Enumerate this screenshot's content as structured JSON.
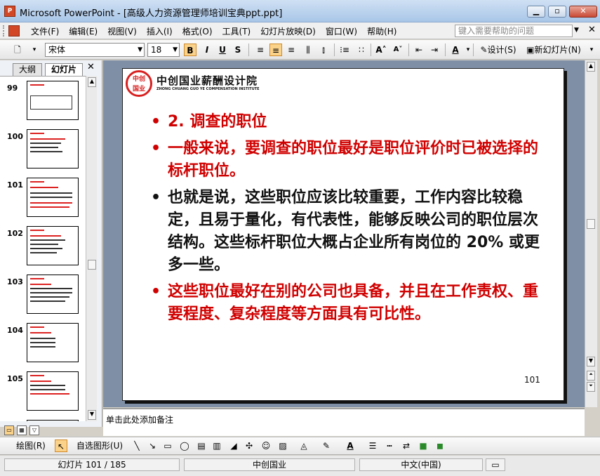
{
  "window": {
    "title": "Microsoft PowerPoint - [高级人力资源管理师培训宝典ppt.ppt]",
    "app_icon": "P"
  },
  "menu": {
    "items": [
      "文件(F)",
      "编辑(E)",
      "视图(V)",
      "插入(I)",
      "格式(O)",
      "工具(T)",
      "幻灯片放映(D)",
      "窗口(W)",
      "帮助(H)"
    ],
    "help_placeholder": "键入需要帮助的问题"
  },
  "format_toolbar": {
    "font": "宋体",
    "size": "18",
    "bold": "B",
    "italic": "I",
    "underline": "U",
    "shadow": "S",
    "design_label": "设计(S)",
    "new_slide_label": "新幻灯片(N)"
  },
  "left_panel": {
    "tabs": [
      "大纲",
      "幻灯片"
    ],
    "active_tab": "幻灯片",
    "slide_numbers": [
      "99",
      "100",
      "101",
      "102",
      "103",
      "104",
      "105"
    ]
  },
  "slide": {
    "logo_seal_top": "中创",
    "logo_seal_bottom": "国业",
    "logo_name": "中创国业薪酬设计院",
    "logo_en": "ZHONG CHUANG GUO YE COMPENSATION INSTITUTE",
    "bullets": [
      {
        "text": "2. 调查的职位",
        "color": "#d00000"
      },
      {
        "text": "一般来说，要调查的职位最好是职位评价时已被选择的标杆职位。",
        "color": "#d00000"
      },
      {
        "text": "也就是说，这些职位应该比较重要，工作内容比较稳定，且易于量化，有代表性，能够反映公司的职位层次结构。这些标杆职位大概占企业所有岗位的 20% 或更多一些。",
        "color": "#111111"
      },
      {
        "text": "这些职位最好在别的公司也具备，并且在工作责权、重要程度、复杂程度等方面具有可比性。",
        "color": "#d00000"
      }
    ],
    "page_number": "101"
  },
  "notes": {
    "placeholder": "单击此处添加备注"
  },
  "draw_toolbar": {
    "draw_label": "绘图(R)",
    "autoshape_label": "自选图形(U)"
  },
  "status": {
    "slide_info": "幻灯片 101 / 185",
    "design": "中创国业",
    "language": "中文(中国)"
  }
}
